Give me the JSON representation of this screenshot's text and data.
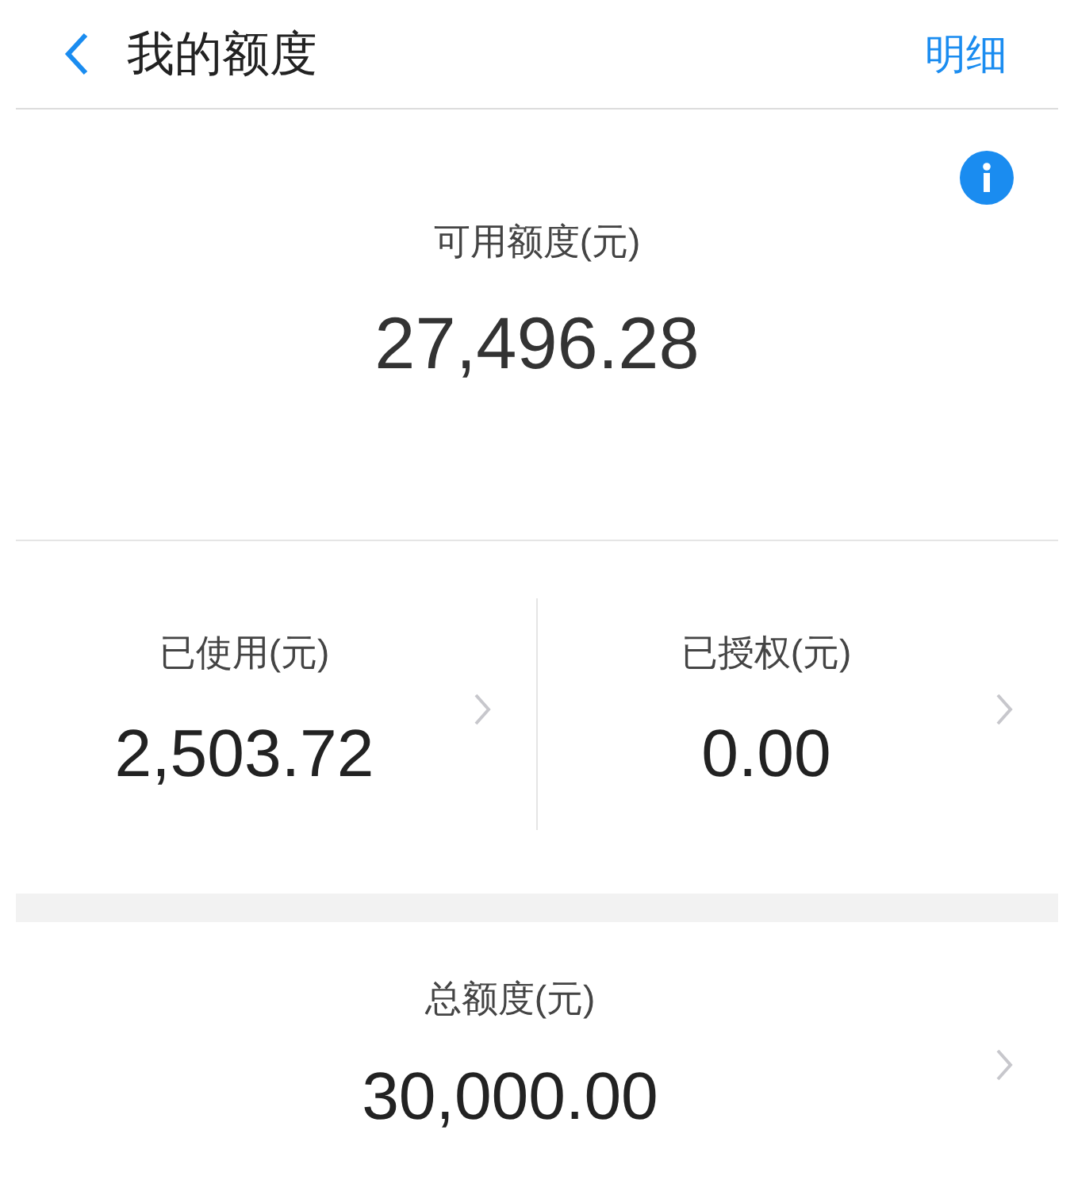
{
  "header": {
    "title": "我的额度",
    "action": "明细"
  },
  "available": {
    "label": "可用额度(元)",
    "amount": "27,496.28"
  },
  "breakdown": [
    {
      "label": "已使用(元)",
      "amount": "2,503.72"
    },
    {
      "label": "已授权(元)",
      "amount": "0.00"
    }
  ],
  "total": {
    "label": "总额度(元)",
    "amount": "30,000.00"
  }
}
